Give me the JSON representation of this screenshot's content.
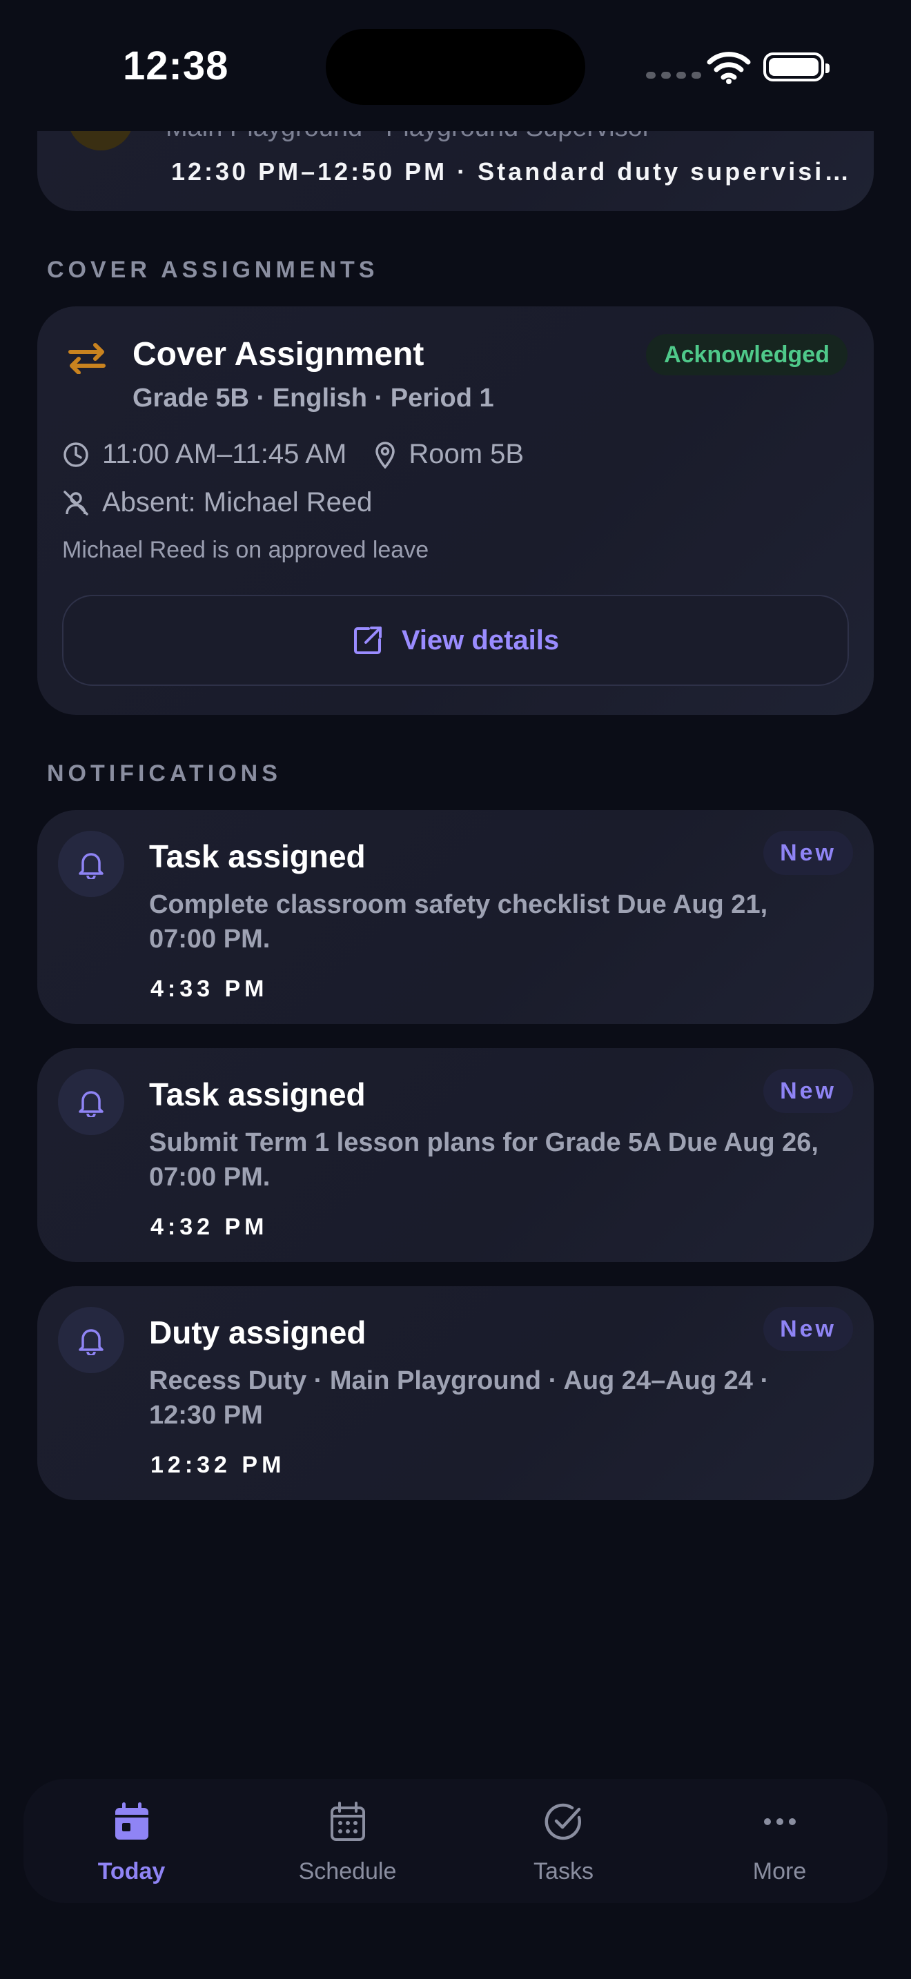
{
  "status_bar": {
    "time": "12:38"
  },
  "previous_duty": {
    "subtitle": "Main Playground · Playground Supervisor",
    "meta": "12:30 PM–12:50 PM · Standard duty supervisi…"
  },
  "cover_section": {
    "label": "COVER ASSIGNMENTS",
    "card": {
      "title": "Cover Assignment",
      "status": "Acknowledged",
      "subtitle": "Grade 5B · English · Period 1",
      "time": "11:00 AM–11:45 AM",
      "room": "Room 5B",
      "absent": "Absent: Michael Reed",
      "note": "Michael Reed is on approved leave",
      "button_label": "View details",
      "status_color": "#4fc98a"
    }
  },
  "notifications": {
    "label": "NOTIFICATIONS",
    "items": [
      {
        "title": "Task assigned",
        "badge": "New",
        "body": "Complete classroom safety checklist Due Aug 21, 07:00 PM.",
        "time": "4:33 PM"
      },
      {
        "title": "Task assigned",
        "badge": "New",
        "body": "Submit Term 1 lesson plans for Grade 5A Due Aug 26, 07:00 PM.",
        "time": "4:32 PM"
      },
      {
        "title": "Duty assigned",
        "badge": "New",
        "body": "Recess Duty · Main Playground · Aug 24–Aug 24 · 12:30 PM",
        "time": "12:32 PM"
      }
    ]
  },
  "bottom_nav": {
    "accent": "#8f84f5",
    "tabs": [
      {
        "label": "Today",
        "icon": "calendar-today-icon",
        "active": true
      },
      {
        "label": "Schedule",
        "icon": "calendar-icon",
        "active": false
      },
      {
        "label": "Tasks",
        "icon": "check-circle-icon",
        "active": false
      },
      {
        "label": "More",
        "icon": "more-dots-icon",
        "active": false
      }
    ]
  }
}
